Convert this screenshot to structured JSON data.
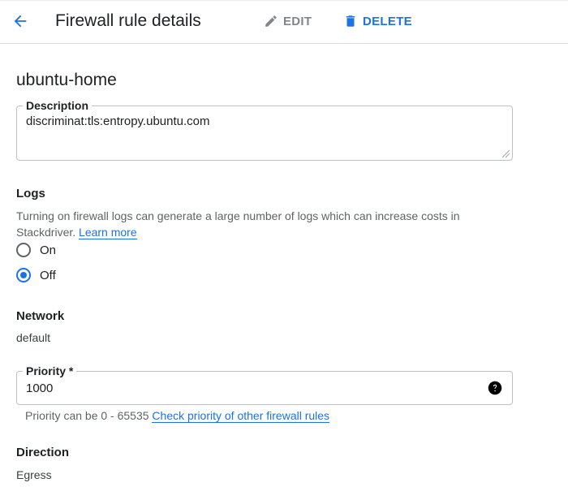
{
  "header": {
    "title": "Firewall rule details",
    "edit_label": "EDIT",
    "delete_label": "DELETE",
    "accent_color": "#1a73e8",
    "disabled_color": "#80868b"
  },
  "rule": {
    "name": "ubuntu-home",
    "description": {
      "label": "Description",
      "value": "discriminat:tls:entropy.ubuntu.com"
    },
    "logs": {
      "label": "Logs",
      "description": "Turning on firewall logs can generate a large number of logs which can increase costs in Stackdriver.",
      "learn_more": "Learn more",
      "options": [
        {
          "label": "On",
          "checked": false
        },
        {
          "label": "Off",
          "checked": true
        }
      ]
    },
    "network": {
      "label": "Network",
      "value": "default"
    },
    "priority": {
      "label": "Priority *",
      "value": "1000",
      "hint": "Priority can be 0 - 65535",
      "hint_link": "Check priority of other firewall rules"
    },
    "direction": {
      "label": "Direction",
      "value": "Egress"
    }
  }
}
